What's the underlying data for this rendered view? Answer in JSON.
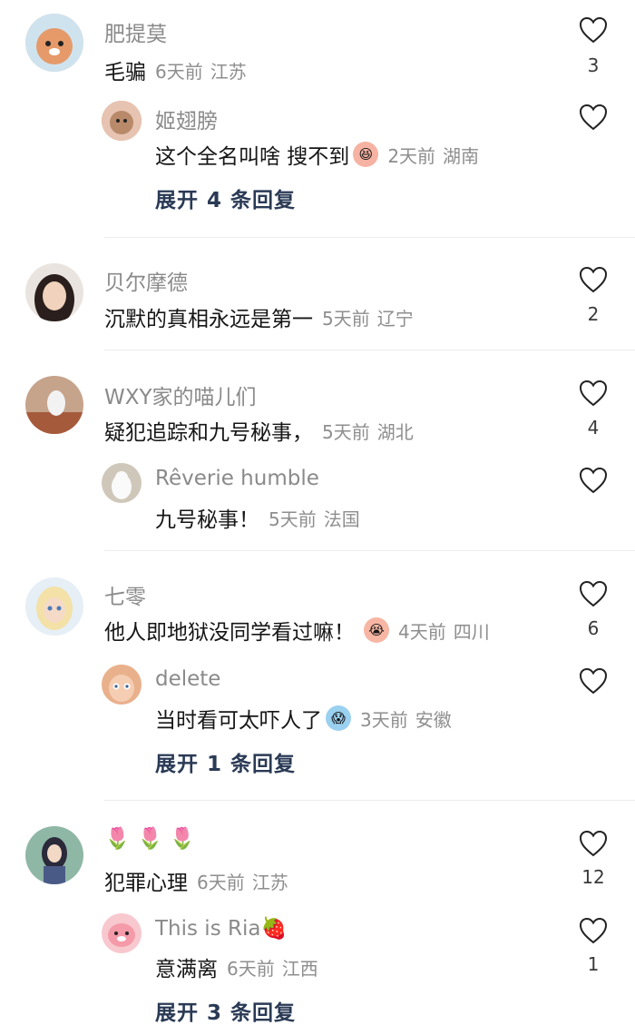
{
  "comments": [
    {
      "user": "肥提莫",
      "text": "毛骗",
      "time": "6天前",
      "location": "江苏",
      "likes": "3",
      "avatar_color": "#e9b48a",
      "replies": [
        {
          "user": "姬翅膀",
          "text": "这个全名叫啥 搜不到",
          "emoji": "laughing-tears-emoji",
          "time": "2天前",
          "location": "湖南",
          "avatar_color": "#c79a7a"
        }
      ],
      "expand": "展开 4 条回复"
    },
    {
      "user": "贝尔摩德",
      "text": "沉默的真相永远是第一",
      "time": "5天前",
      "location": "辽宁",
      "likes": "2",
      "avatar_color": "#4a3a36",
      "replies": []
    },
    {
      "user": "WXY家的喵儿们",
      "text": "疑犯追踪和九号秘事，",
      "time": "5天前",
      "location": "湖北",
      "likes": "4",
      "avatar_color": "#b98a6e",
      "replies": [
        {
          "user": "Rêverie humble",
          "text": "九号秘事！",
          "time": "5天前",
          "location": "法国",
          "avatar_color": "#d8d2c8"
        }
      ]
    },
    {
      "user": "七零",
      "text": "他人即地狱没同学看过嘛！",
      "emoji": "crying-face-emoji",
      "time": "4天前",
      "location": "四川",
      "likes": "6",
      "avatar_color": "#d9e6f2",
      "replies": [
        {
          "user": "delete",
          "text": "当时看可太吓人了",
          "emoji": "scared-face-emoji",
          "time": "3天前",
          "location": "安徽",
          "avatar_color": "#e3a887"
        }
      ],
      "expand": "展开 1 条回复"
    },
    {
      "user": "🌷 🌷 🌷",
      "text": "犯罪心理",
      "time": "6天前",
      "location": "江苏",
      "likes": "12",
      "avatar_color": "#5f8a78",
      "replies": [
        {
          "user": "This is Ria🍓",
          "text": "意满离",
          "time": "6天前",
          "location": "江西",
          "likes": "1",
          "avatar_color": "#f0a7b0"
        }
      ],
      "expand": "展开 3 条回复"
    }
  ],
  "colors": {
    "accent_link": "#2a3a55",
    "meta": "#8e8e8e",
    "divider": "#ececec"
  }
}
